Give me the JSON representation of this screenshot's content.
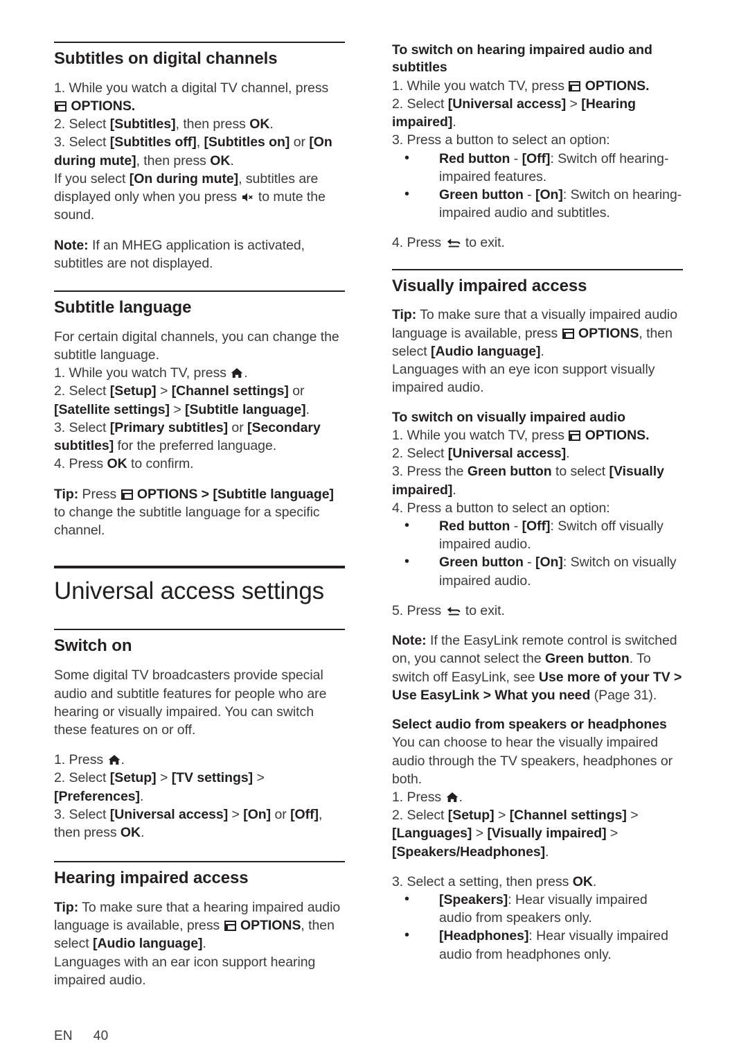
{
  "page": {
    "language_code": "EN",
    "page_number": "40"
  },
  "left_column": {
    "section_subtitles_digital": {
      "heading": "Subtitles on digital channels",
      "step1_a": "1. While you watch a digital TV channel, press ",
      "step1_b": " OPTIONS.",
      "step2_a": "2. Select ",
      "step2_b": "[Subtitles]",
      "step2_c": ", then press ",
      "step2_d": "OK",
      "step2_e": ".",
      "step3_a": "3. Select ",
      "step3_b": "[Subtitles off]",
      "step3_c": ", ",
      "step3_d": "[Subtitles on]",
      "step3_e": " or ",
      "step3_f": "[On during mute]",
      "step3_g": ", then press ",
      "step3_h": "OK",
      "step3_i": ".",
      "step3_note_a": "If you select ",
      "step3_note_b": "[On during mute]",
      "step3_note_c": ", subtitles are displayed only when you press ",
      "step3_note_d": " to mute the sound.",
      "note_label": "Note:",
      "note_text": " If an MHEG application is activated, subtitles are not displayed."
    },
    "section_subtitle_language": {
      "heading": "Subtitle language",
      "intro": "For certain digital channels, you can change the subtitle language.",
      "step1_a": "1. While you watch TV, press ",
      "step1_b": ".",
      "step2_a": "2. Select ",
      "step2_b": "[Setup]",
      "step2_c": " > ",
      "step2_d": "[Channel settings]",
      "step2_e": " or ",
      "step2_f": "[Satellite settings]",
      "step2_g": " > ",
      "step2_h": "[Subtitle language]",
      "step2_i": ".",
      "step3_a": "3. Select ",
      "step3_b": "[Primary subtitles]",
      "step3_c": " or ",
      "step3_d": "[Secondary subtitles]",
      "step3_e": " for the preferred language.",
      "step4_a": "4. Press ",
      "step4_b": "OK",
      "step4_c": " to confirm.",
      "tip_label": "Tip:",
      "tip_a": " Press ",
      "tip_b": " OPTIONS > ",
      "tip_c": "[Subtitle language]",
      "tip_d": " to change the subtitle language for a specific channel."
    },
    "main_title": "Universal access settings",
    "section_switch_on": {
      "heading": "Switch on",
      "intro": "Some digital TV broadcasters provide special audio and subtitle features for people who are hearing or visually impaired. You can switch these features on or off.",
      "step1_a": "1. Press ",
      "step1_b": ".",
      "step2_a": "2. Select ",
      "step2_b": "[Setup]",
      "step2_c": " > ",
      "step2_d": "[TV settings]",
      "step2_e": " > ",
      "step2_f": "[Preferences]",
      "step2_g": ".",
      "step3_a": "3. Select ",
      "step3_b": "[Universal access]",
      "step3_c": " > ",
      "step3_d": "[On]",
      "step3_e": " or ",
      "step3_f": "[Off]",
      "step3_g": ", then press ",
      "step3_h": "OK",
      "step3_i": "."
    },
    "section_hearing_impaired": {
      "heading": "Hearing impaired access",
      "tip_label": "Tip:",
      "tip_a": " To make sure that a hearing impaired audio language is available, press ",
      "tip_b": " OPTIONS",
      "tip_c": ", then select ",
      "tip_d": "[Audio language]",
      "tip_e": ".",
      "body": "Languages with an ear icon support hearing impaired audio."
    }
  },
  "right_column": {
    "switch_on_hearing": {
      "heading": "To switch on hearing impaired audio and subtitles",
      "step1_a": "1. While you watch TV, press ",
      "step1_b": " OPTIONS.",
      "step2_a": "2. Select ",
      "step2_b": "[Universal access]",
      "step2_c": " > ",
      "step2_d": "[Hearing impaired]",
      "step2_e": ".",
      "step3": "3. Press a button to select an option:",
      "bullets": [
        {
          "label": "Red button",
          "mid": " - ",
          "value": "[Off]",
          "text": ": Switch off hearing-impaired features."
        },
        {
          "label": "Green button",
          "mid": " - ",
          "value": "[On]",
          "text": ": Switch on hearing-impaired audio and subtitles."
        }
      ],
      "step4_a": "4. Press ",
      "step4_b": " to exit."
    },
    "section_visually_impaired": {
      "heading": "Visually impaired access",
      "tip_label": "Tip:",
      "tip_a": " To make sure that a visually impaired audio language is available, press ",
      "tip_b": " OPTIONS",
      "tip_c": ", then select ",
      "tip_d": "[Audio language]",
      "tip_e": ".",
      "body": "Languages with an eye icon support visually impaired audio.",
      "sub_heading": "To switch on visually impaired audio",
      "step1_a": "1. While you watch TV, press ",
      "step1_b": " OPTIONS.",
      "step2_a": "2. Select ",
      "step2_b": "[Universal access]",
      "step2_c": ".",
      "step3_a": "3. Press the ",
      "step3_b": "Green button",
      "step3_c": " to select ",
      "step3_d": "[Visually impaired]",
      "step3_e": ".",
      "step4": "4. Press a button to select an option:",
      "bullets": [
        {
          "label": "Red button",
          "mid": " - ",
          "value": "[Off]",
          "text": ": Switch off visually impaired audio."
        },
        {
          "label": "Green button",
          "mid": " - ",
          "value": "[On]",
          "text": ": Switch on visually impaired audio."
        }
      ],
      "step5_a": "5. Press ",
      "step5_b": " to exit.",
      "note_label": "Note:",
      "note_a": " If the EasyLink remote control is switched on, you cannot select the ",
      "note_b": "Green button",
      "note_c": ". To switch off EasyLink, see ",
      "note_d": "Use more of your TV > Use EasyLink > What you need",
      "note_e": " (Page 31)."
    },
    "section_speakers_headphones": {
      "heading": "Select audio from speakers or headphones",
      "intro": "You can choose to hear the visually impaired audio through the TV speakers, headphones or both.",
      "step1_a": "1. Press ",
      "step1_b": ".",
      "step2_a": "2. Select ",
      "step2_b": "[Setup]",
      "step2_c": " > ",
      "step2_d": "[Channel settings]",
      "step2_e": " > ",
      "step2_f": "[Languages]",
      "step2_g": " > ",
      "step2_h": "[Visually impaired]",
      "step2_i": " > ",
      "step2_j": "[Speakers/Headphones]",
      "step2_k": ".",
      "step3_a": "3. Select a setting, then press ",
      "step3_b": "OK",
      "step3_c": ".",
      "bullets": [
        {
          "value": "[Speakers]",
          "text": ": Hear visually impaired audio from speakers only."
        },
        {
          "value": "[Headphones]",
          "text": ": Hear visually impaired audio from headphones only."
        }
      ]
    }
  }
}
